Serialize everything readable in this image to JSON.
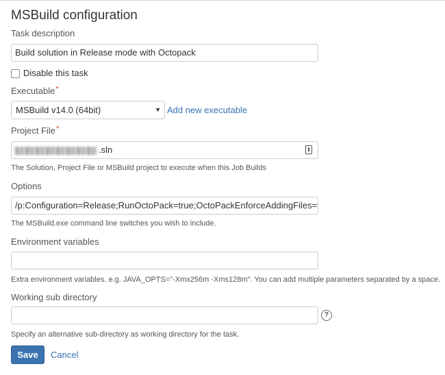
{
  "page": {
    "title": "MSBuild configuration"
  },
  "task_description": {
    "label": "Task description",
    "value": "Build solution in Release mode with Octopack"
  },
  "disable_task": {
    "label": "Disable this task",
    "checked": false
  },
  "executable": {
    "label": "Executable",
    "required": "*",
    "selected": "MSBuild v14.0 (64bit)",
    "add_link": "Add new executable"
  },
  "project_file": {
    "label": "Project File",
    "required": "*",
    "value_suffix": ".sln",
    "help": "The Solution, Project File or MSBuild project to execute when this Job Builds"
  },
  "options": {
    "label": "Options",
    "value": "/p:Configuration=Release;RunOctoPack=true;OctoPackEnforceAddingFiles=true",
    "help": "The MSBuild.exe command line switches you wish to include."
  },
  "environment_variables": {
    "label": "Environment variables",
    "value": "",
    "help": "Extra environment variables. e.g. JAVA_OPTS=\"-Xmx256m -Xms128m\". You can add multiple parameters separated by a space."
  },
  "working_sub_directory": {
    "label": "Working sub directory",
    "value": "",
    "help_icon": "?",
    "help": "Specify an alternative sub-directory as working directory for the task."
  },
  "actions": {
    "save_label": "Save",
    "cancel_label": "Cancel"
  },
  "colors": {
    "accent": "#3b73af",
    "link": "#3572b0",
    "required": "#d04437"
  }
}
